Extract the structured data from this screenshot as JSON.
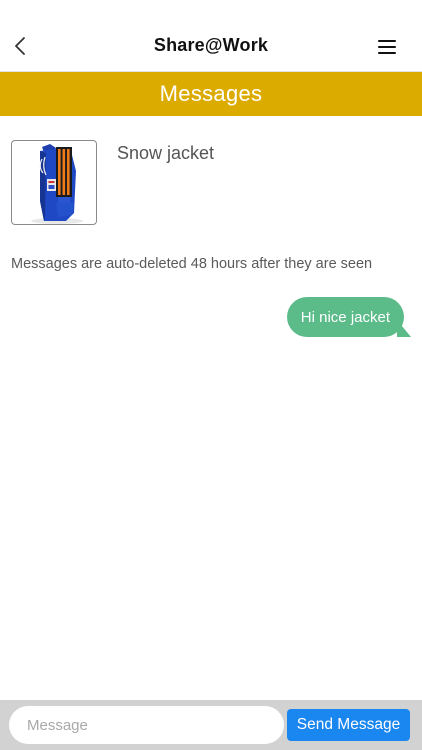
{
  "header": {
    "title": "Share@Work",
    "back_icon": "chevron-left-icon",
    "menu_icon": "hamburger-menu-icon"
  },
  "banner": {
    "title": "Messages",
    "color": "#dcab00"
  },
  "item": {
    "title": "Snow jacket",
    "image": "blue snow jacket with orange stripes"
  },
  "notice": "Messages are auto-deleted 48 hours after they are seen",
  "messages": [
    {
      "text": "Hi nice jacket",
      "direction": "outgoing",
      "color": "#5bbb89"
    }
  ],
  "composer": {
    "placeholder": "Message",
    "value": "",
    "send_label": "Send Message",
    "send_color": "#1a86f0"
  }
}
